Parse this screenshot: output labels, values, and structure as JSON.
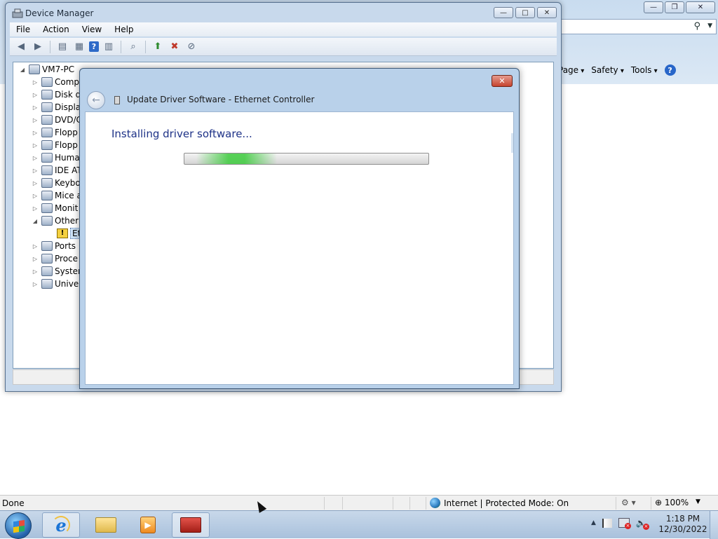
{
  "ie": {
    "title_buttons": {
      "minimize": "—",
      "restore": "❐",
      "close": "✕"
    },
    "search_icon": "search-icon",
    "command_bar": [
      "Page",
      "Safety",
      "Tools"
    ],
    "status": {
      "text": "Done",
      "zone": "Internet | Protected Mode: On",
      "zoom": "100%"
    }
  },
  "device_manager": {
    "title": "Device Manager",
    "controls": {
      "minimize": "—",
      "maximize": "□",
      "close": "✕"
    },
    "menu": [
      "File",
      "Action",
      "View",
      "Help"
    ],
    "toolbar_icons": [
      "back-icon",
      "forward-icon",
      "console-tree-icon",
      "properties-icon",
      "help-icon",
      "action-pane-icon",
      "scan-hardware-icon",
      "update-driver-icon",
      "disable-device-icon",
      "uninstall-icon"
    ],
    "tree": {
      "root": "VM7-PC",
      "items": [
        {
          "label": "Comp",
          "expanded": false
        },
        {
          "label": "Disk d",
          "expanded": false
        },
        {
          "label": "Displa",
          "expanded": false
        },
        {
          "label": "DVD/C",
          "expanded": false
        },
        {
          "label": "Flopp",
          "expanded": false
        },
        {
          "label": "Flopp",
          "expanded": false
        },
        {
          "label": "Huma",
          "expanded": false
        },
        {
          "label": "IDE AT",
          "expanded": false
        },
        {
          "label": "Keybo",
          "expanded": false
        },
        {
          "label": "Mice a",
          "expanded": false
        },
        {
          "label": "Monit",
          "expanded": false
        },
        {
          "label": "Other",
          "expanded": true
        },
        {
          "label": "Eth",
          "child": true,
          "selected": true
        },
        {
          "label": "Ports",
          "expanded": false
        },
        {
          "label": "Proce",
          "expanded": false
        },
        {
          "label": "Syster",
          "expanded": false
        },
        {
          "label": "Unive",
          "expanded": false
        }
      ]
    }
  },
  "update_driver": {
    "title": "Update Driver Software - Ethernet Controller",
    "close": "✕",
    "back": "←",
    "heading": "Installing driver software...",
    "progress": {
      "mode": "marquee",
      "highlight_start": 0.05,
      "highlight_end": 0.38
    }
  },
  "taskbar": {
    "apps": [
      "internet-explorer",
      "windows-explorer",
      "windows-media-player",
      "device-manager"
    ],
    "clock": {
      "time": "1:18 PM",
      "date": "12/30/2022"
    },
    "tray_icons": [
      "show-hidden-icons",
      "action-center-icon",
      "network-icon",
      "volume-icon"
    ]
  },
  "colors": {
    "heading_blue": "#1e3287",
    "progress_green": "#3ccb3c",
    "close_red": "#c6432e"
  }
}
